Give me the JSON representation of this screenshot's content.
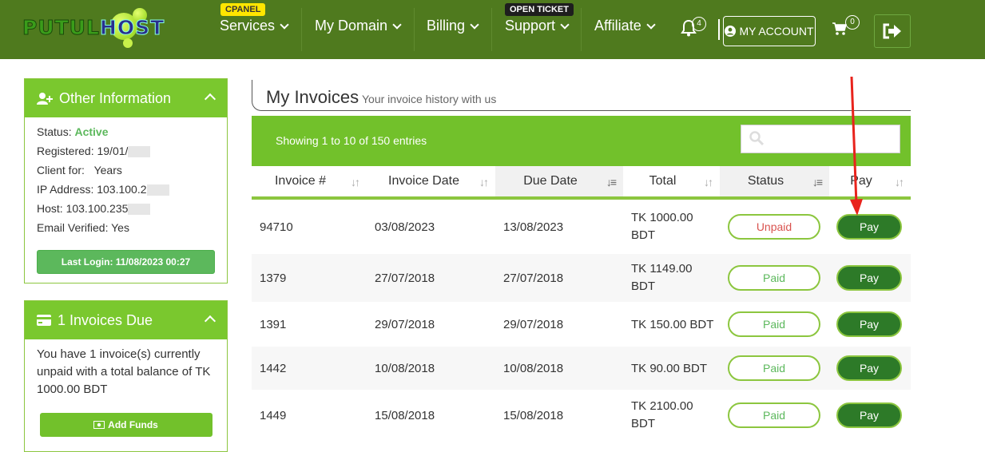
{
  "logo": {
    "part1": "PUTUL",
    "part2": "HOST"
  },
  "nav": {
    "cpanel_badge": "CPANEL",
    "ticket_badge": "OPEN TICKET",
    "services": "Services",
    "my_domain": "My Domain",
    "billing": "Billing",
    "support": "Support",
    "affiliate": "Affiliate",
    "notifications_count": "4",
    "my_account": "MY ACCOUNT",
    "cart_count": "0"
  },
  "other_info": {
    "title": "Other Information",
    "status_label": "Status:",
    "status_value": "Active",
    "registered": "Registered: 19/01/",
    "client_for_label": "Client for:",
    "client_for_value": "Years",
    "ip_address": "IP Address: 103.100.2",
    "host": "Host: 103.100.235",
    "email_verified": "Email Verified: Yes",
    "last_login": "Last Login: 11/08/2023 00:27"
  },
  "invoices_due": {
    "title": "1 Invoices Due",
    "message": "You have 1 invoice(s) currently unpaid with a total balance of TK 1000.00 BDT",
    "add_funds": "Add Funds"
  },
  "main": {
    "title": "My Invoices",
    "subtitle": "Your invoice history with us",
    "showing": "Showing 1 to 10 of 150 entries"
  },
  "table": {
    "headers": {
      "invoice": "Invoice #",
      "invoice_date": "Invoice Date",
      "due_date": "Due Date",
      "total": "Total",
      "status": "Status",
      "pay": "Pay"
    },
    "rows": [
      {
        "invoice": "94710",
        "invoice_date": "03/08/2023",
        "due_date": "13/08/2023",
        "total": "TK 1000.00 BDT",
        "status": "Unpaid",
        "pay": "Pay"
      },
      {
        "invoice": "1379",
        "invoice_date": "27/07/2018",
        "due_date": "27/07/2018",
        "total": "TK 1149.00 BDT",
        "status": "Paid",
        "pay": "Pay"
      },
      {
        "invoice": "1391",
        "invoice_date": "29/07/2018",
        "due_date": "29/07/2018",
        "total": "TK 150.00 BDT",
        "status": "Paid",
        "pay": "Pay"
      },
      {
        "invoice": "1442",
        "invoice_date": "10/08/2018",
        "due_date": "10/08/2018",
        "total": "TK 90.00 BDT",
        "status": "Paid",
        "pay": "Pay"
      },
      {
        "invoice": "1449",
        "invoice_date": "15/08/2018",
        "due_date": "15/08/2018",
        "total": "TK 2100.00 BDT",
        "status": "Paid",
        "pay": "Pay"
      }
    ]
  },
  "colors": {
    "nav_bg": "#4f7a1e",
    "accent_green": "#72c12b",
    "pay_button": "#2d7a28",
    "unpaid_red": "#d9534f",
    "annotation_arrow": "#e8231c"
  }
}
